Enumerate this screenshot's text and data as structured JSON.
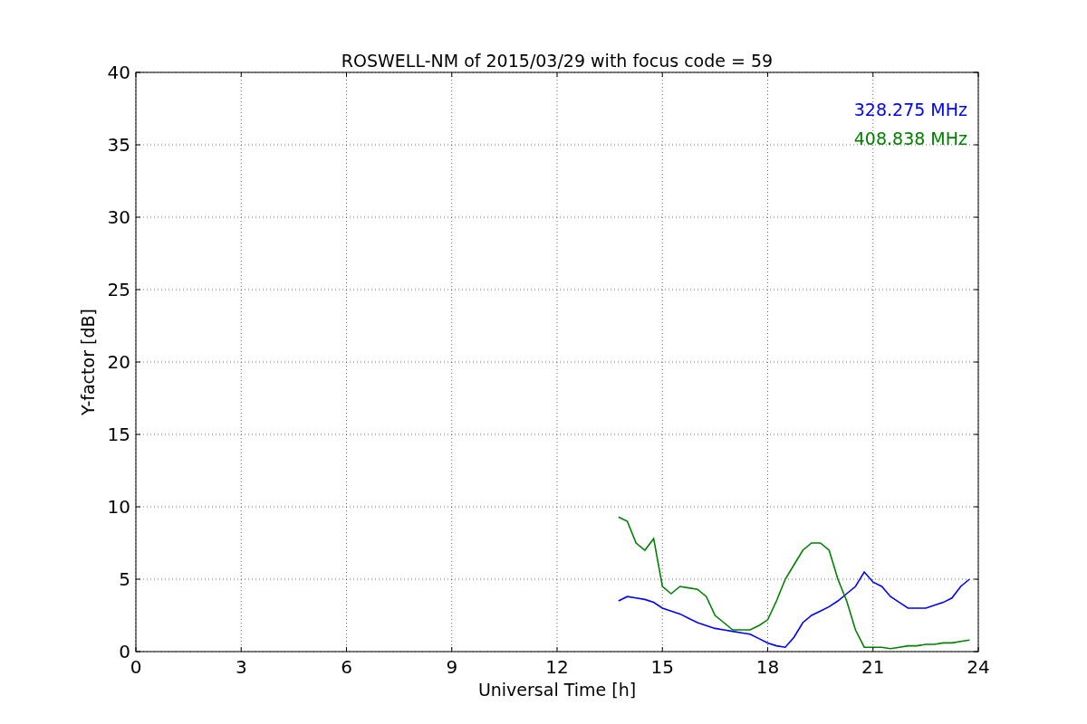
{
  "chart_data": {
    "type": "line",
    "title": "ROSWELL-NM of 2015/03/29 with focus code = 59",
    "xlabel": "Universal Time [h]",
    "ylabel": "Y-factor [dB]",
    "x": [
      13.75,
      14,
      14.25,
      14.5,
      14.75,
      15,
      15.25,
      15.5,
      15.75,
      16,
      16.25,
      16.5,
      16.75,
      17,
      17.25,
      17.5,
      17.75,
      18,
      18.25,
      18.5,
      18.75,
      19,
      19.25,
      19.5,
      19.75,
      20,
      20.25,
      20.5,
      20.75,
      21,
      21.25,
      21.5,
      21.75,
      22,
      22.25,
      22.5,
      22.75,
      23,
      23.25,
      23.5,
      23.75
    ],
    "series": [
      {
        "name": "328.275 MHz",
        "color": "#0000ff",
        "values": [
          3.5,
          3.8,
          3.7,
          3.6,
          3.4,
          3.0,
          2.8,
          2.6,
          2.3,
          2.0,
          1.8,
          1.6,
          1.5,
          1.4,
          1.3,
          1.2,
          0.9,
          0.6,
          0.4,
          0.3,
          1.0,
          2.0,
          2.5,
          2.8,
          3.1,
          3.5,
          4.0,
          4.5,
          5.5,
          4.8,
          4.5,
          3.8,
          3.4,
          3.0,
          3.0,
          3.0,
          3.2,
          3.4,
          3.7,
          4.5,
          5.0
        ]
      },
      {
        "name": "408.838 MHz",
        "color": "#008000",
        "values": [
          9.3,
          9.0,
          7.5,
          7.0,
          7.8,
          4.5,
          4.0,
          4.5,
          4.4,
          4.3,
          3.8,
          2.5,
          2.0,
          1.5,
          1.5,
          1.5,
          1.8,
          2.2,
          3.5,
          5.0,
          6.0,
          7.0,
          7.5,
          7.5,
          7.0,
          5.0,
          3.5,
          1.5,
          0.3,
          0.3,
          0.3,
          0.2,
          0.3,
          0.4,
          0.4,
          0.5,
          0.5,
          0.6,
          0.6,
          0.7,
          0.8
        ]
      }
    ],
    "grid": true,
    "xlim": [
      0,
      24
    ],
    "ylim": [
      0,
      40
    ],
    "xticks": [
      0,
      3,
      6,
      9,
      12,
      15,
      18,
      21,
      24
    ],
    "yticks": [
      0,
      5,
      10,
      15,
      20,
      25,
      30,
      35,
      40
    ]
  }
}
